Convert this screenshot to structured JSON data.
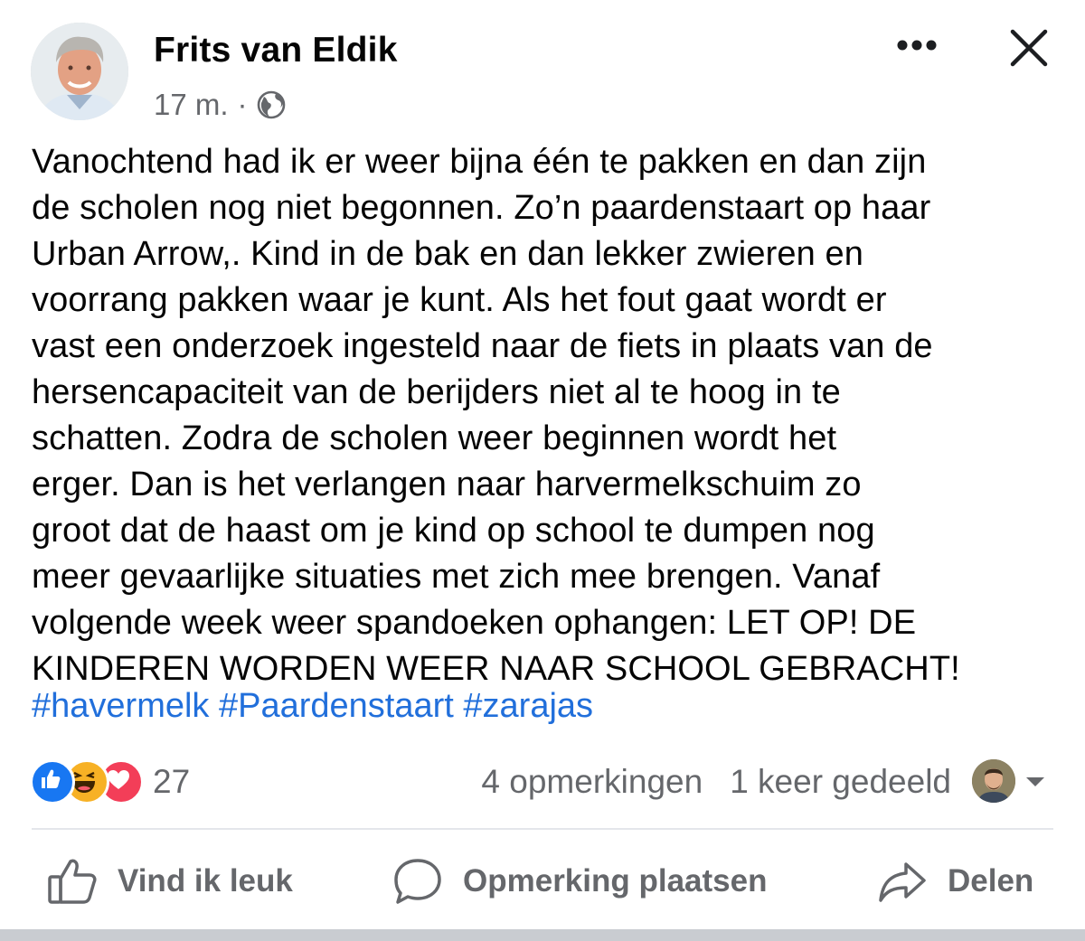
{
  "post": {
    "author": "Frits van Eldik",
    "time": "17 m.",
    "separator": "·",
    "privacy_icon": "globe-icon",
    "text_lines": [
      "Vanochtend had ik er weer bijna één te pakken en dan zijn",
      "de scholen nog niet begonnen. Zo’n paardenstaart op haar",
      "Urban Arrow,. Kind in de bak en dan lekker zwieren en",
      "voorrang pakken waar je kunt. Als het fout gaat wordt er",
      "vast een onderzoek ingesteld naar de fiets in plaats van de",
      "hersencapaciteit van de berijders niet al te hoog in te",
      "schatten. Zodra de scholen weer beginnen wordt het",
      "erger. Dan is het verlangen naar harvermelkschuim zo",
      "groot dat de haast om je kind op school te dumpen nog",
      "meer gevaarlijke situaties met zich mee brengen. Vanaf",
      "volgende week weer spandoeken ophangen: LET OP! DE",
      "KINDEREN WORDEN WEER NAAR SCHOOL GEBRACHT!"
    ],
    "hashtags": [
      "#havermelk",
      "#Paardenstaart",
      "#zarajas"
    ]
  },
  "reactions": {
    "types": [
      "like",
      "haha",
      "love"
    ],
    "count": "27",
    "comments": "4 opmerkingen",
    "shares": "1 keer gedeeld"
  },
  "actions": {
    "like": "Vind ik leuk",
    "comment": "Opmerking plaatsen",
    "share": "Delen"
  },
  "colors": {
    "text": "#050505",
    "secondary": "#65676b",
    "hashtag": "#216fdb",
    "like_blue": "#1877f2",
    "love_red": "#f33e58",
    "haha_yellow": "#f7b125"
  },
  "icons": [
    "more-icon",
    "close-icon",
    "globe-icon",
    "thumbs-up-icon",
    "comment-bubble-icon",
    "share-arrow-icon",
    "caret-down-icon"
  ]
}
